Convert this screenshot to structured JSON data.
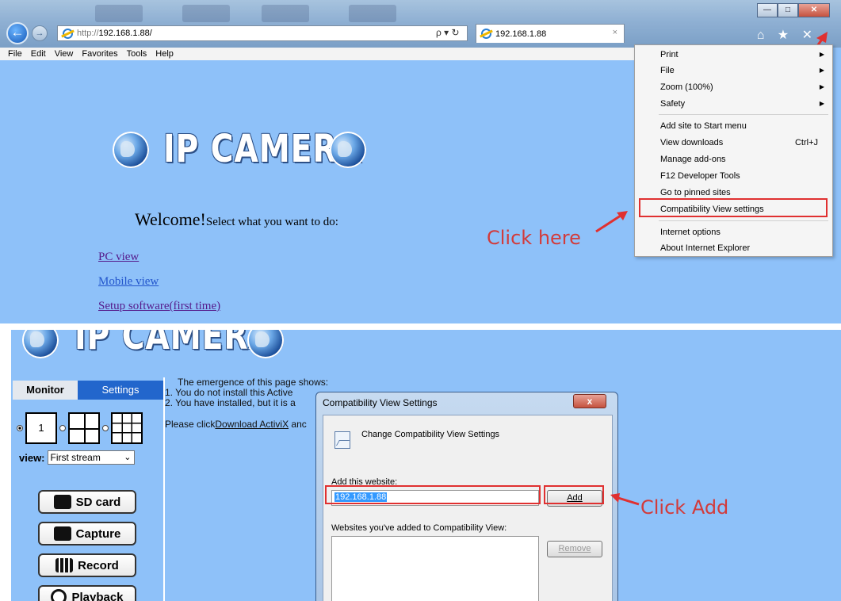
{
  "browser": {
    "url_protocol": "http://",
    "url_host": "192.168.1.88/",
    "address_tools": "ρ ▾ ↻",
    "tab_title": "192.168.1.88",
    "tab_close": "×",
    "toolbar_icons": "⌂ ★ ✕",
    "window_controls": {
      "minimize": "—",
      "maximize": "□",
      "close": "✕"
    },
    "menubar": [
      "File",
      "Edit",
      "View",
      "Favorites",
      "Tools",
      "Help"
    ]
  },
  "ip_page": {
    "brand": "IP CAMERA",
    "welcome_big": "Welcome!",
    "welcome_small": "Select what you want to do:",
    "links": [
      "PC view",
      "Mobile view",
      "Setup software(first time)"
    ]
  },
  "tools_menu": {
    "items": [
      {
        "label": "Print",
        "submenu": true
      },
      {
        "label": "File",
        "submenu": true
      },
      {
        "label": "Zoom (100%)",
        "submenu": true
      },
      {
        "label": "Safety",
        "submenu": true
      },
      {
        "label": "Add site to Start menu"
      },
      {
        "label": "View downloads",
        "shortcut": "Ctrl+J"
      },
      {
        "label": "Manage add-ons"
      },
      {
        "label": "F12 Developer Tools"
      },
      {
        "label": "Go to pinned sites"
      },
      {
        "label": "Compatibility View settings",
        "highlighted": true
      },
      {
        "label": "Internet options"
      },
      {
        "label": "About Internet Explorer"
      }
    ],
    "submenu_arrow": "▶"
  },
  "annotations": {
    "click_here": "Click here",
    "click_add": "Click Add",
    "color": "#e03030"
  },
  "camera_page": {
    "brand": "IP CAMERA",
    "tabs": {
      "monitor": "Monitor",
      "settings": "Settings"
    },
    "layout_selected": "1",
    "view_label": "view:",
    "view_value": "First stream",
    "buttons": [
      "SD card",
      "Capture",
      "Record",
      "Playback"
    ],
    "notice": {
      "line0": "The emergence of this page shows:",
      "line1": "1. You do not install this Active",
      "line2": "2. You have installed, but it is a",
      "line3_prefix": "Please click",
      "line3_link": "Download ActiviX",
      "line3_suffix": " anc"
    }
  },
  "compat_dialog": {
    "title": "Compatibility View Settings",
    "close_label": "x",
    "heading": "Change Compatibility View Settings",
    "add_label": "Add this website:",
    "add_value": "192.168.1.88",
    "add_button": "Add",
    "list_label": "Websites you've added to Compatibility View:",
    "remove_button": "Remove"
  }
}
